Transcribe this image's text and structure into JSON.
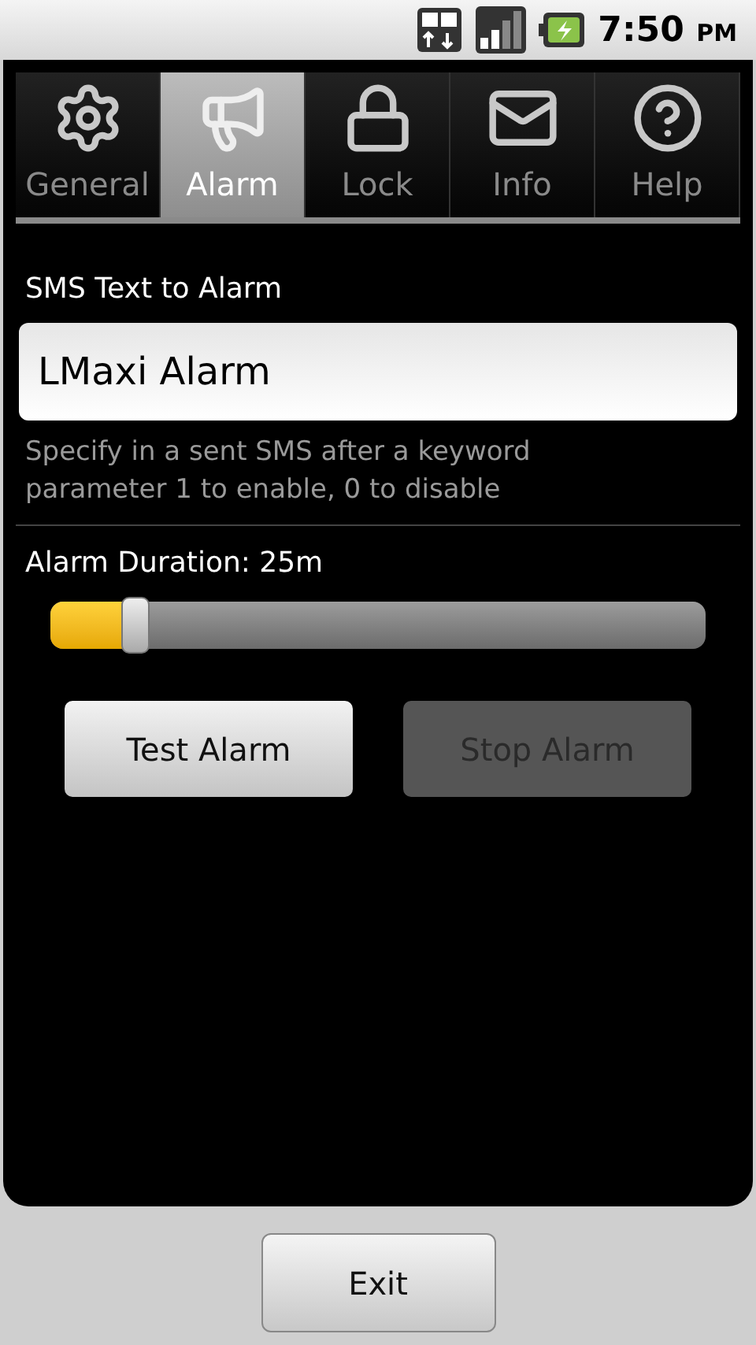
{
  "status_bar": {
    "time": "7:50",
    "ampm": "PM"
  },
  "tabs": [
    {
      "label": "General",
      "selected": false
    },
    {
      "label": "Alarm",
      "selected": true
    },
    {
      "label": "Lock",
      "selected": false
    },
    {
      "label": "Info",
      "selected": false
    },
    {
      "label": "Help",
      "selected": false
    }
  ],
  "sms_field": {
    "label": "SMS Text to Alarm",
    "value": "LMaxi Alarm",
    "hint": "Specify in a sent SMS after a keyword parameter 1 to enable, 0 to disable"
  },
  "duration": {
    "label": "Alarm Duration: 25m",
    "level": 0.13
  },
  "buttons": [
    {
      "label": "Test Alarm",
      "disabled": false
    },
    {
      "label": "Stop Alarm",
      "disabled": true
    }
  ],
  "exit_button": {
    "label": "Exit"
  }
}
